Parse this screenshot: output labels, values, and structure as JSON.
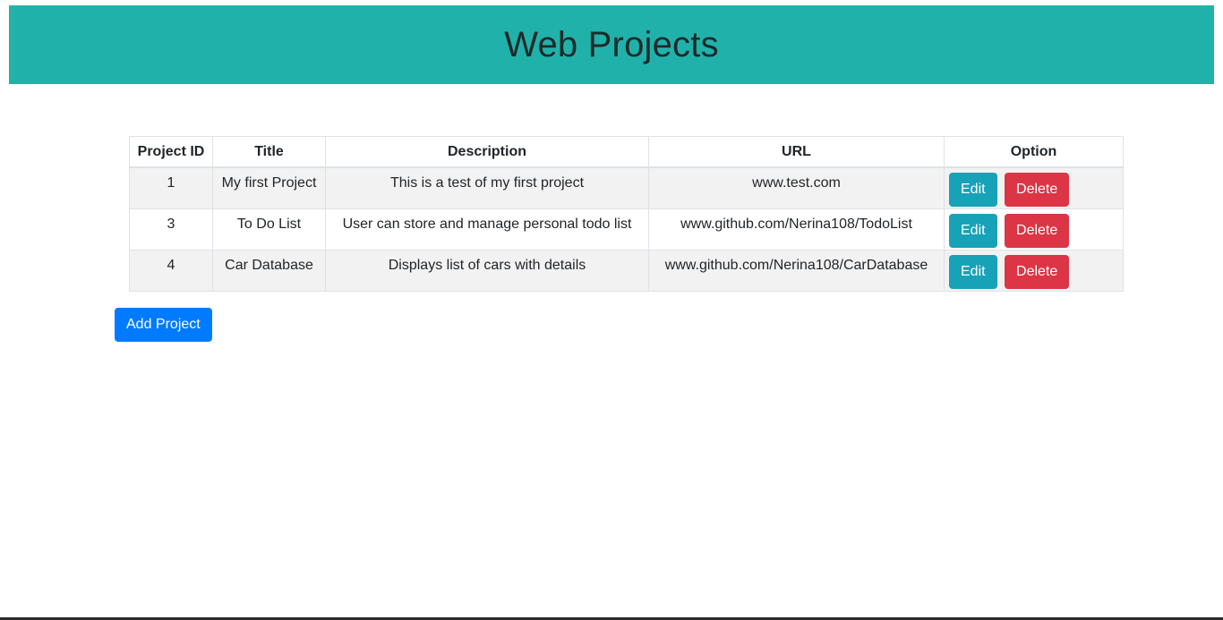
{
  "header": {
    "title": "Web Projects"
  },
  "table": {
    "columns": [
      "Project ID",
      "Title",
      "Description",
      "URL",
      "Option"
    ],
    "rows": [
      {
        "id": "1",
        "title": "My first Project",
        "description": "This is a test of my first project",
        "url": "www.test.com"
      },
      {
        "id": "3",
        "title": "To Do List",
        "description": "User can store and manage personal todo list",
        "url": "www.github.com/Nerina108/TodoList"
      },
      {
        "id": "4",
        "title": "Car Database",
        "description": "Displays list of cars with details",
        "url": "www.github.com/Nerina108/CarDatabase"
      }
    ],
    "edit_label": "Edit",
    "delete_label": "Delete"
  },
  "actions": {
    "add_label": "Add Project"
  },
  "colors": {
    "header_bg": "#20b2aa",
    "edit": "#17a2b8",
    "delete": "#dc3545",
    "add": "#007bff"
  }
}
